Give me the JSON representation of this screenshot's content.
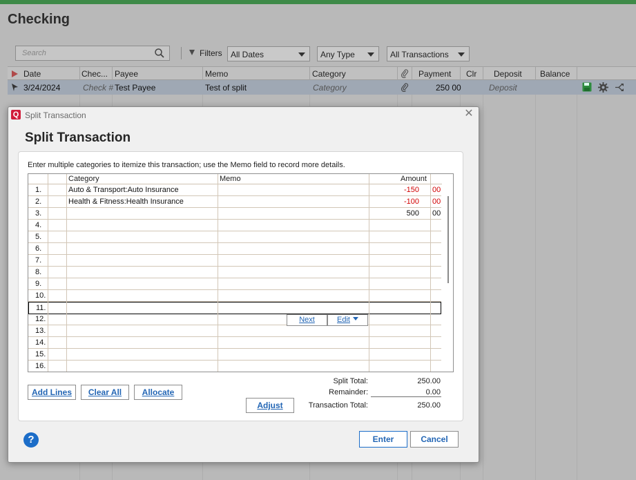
{
  "register": {
    "title": "Checking",
    "search_placeholder": "Search",
    "filters_label": "Filters",
    "date_filter": "All Dates",
    "type_filter": "Any Type",
    "txn_filter": "All Transactions",
    "columns": [
      "Date",
      "Chec...",
      "Payee",
      "Memo",
      "Category",
      "Payment",
      "Clr",
      "Deposit",
      "Balance"
    ],
    "row": {
      "date": "3/24/2024",
      "check": "Check #",
      "payee": "Test Payee",
      "memo": "Test of split",
      "category": "Category",
      "payment": "250 00",
      "deposit": "Deposit"
    }
  },
  "dialog": {
    "window_title": "Split Transaction",
    "logo": "Q",
    "heading": "Split Transaction",
    "instructions": "Enter multiple categories to itemize this transaction; use the Memo field to record more details.",
    "columns": {
      "category": "Category",
      "memo": "Memo",
      "amount": "Amount"
    },
    "rows": [
      {
        "n": "1.",
        "category": "Auto & Transport:Auto Insurance",
        "amount": "-150",
        "cents": "00",
        "negative": true
      },
      {
        "n": "2.",
        "category": "Health & Fitness:Health Insurance",
        "amount": "-100",
        "cents": "00",
        "negative": true
      },
      {
        "n": "3.",
        "category": "",
        "amount": "500",
        "cents": "00",
        "negative": false
      },
      {
        "n": "4.",
        "category": "",
        "amount": "",
        "cents": ""
      },
      {
        "n": "5.",
        "category": "",
        "amount": "",
        "cents": ""
      },
      {
        "n": "6.",
        "category": "",
        "amount": "",
        "cents": ""
      },
      {
        "n": "7.",
        "category": "",
        "amount": "",
        "cents": ""
      },
      {
        "n": "8.",
        "category": "",
        "amount": "",
        "cents": ""
      },
      {
        "n": "9.",
        "category": "",
        "amount": "",
        "cents": ""
      },
      {
        "n": "10.",
        "category": "",
        "amount": "",
        "cents": ""
      },
      {
        "n": "11.",
        "category": "",
        "amount": "",
        "cents": ""
      },
      {
        "n": "12.",
        "category": "",
        "amount": "",
        "cents": ""
      },
      {
        "n": "13.",
        "category": "",
        "amount": "",
        "cents": ""
      },
      {
        "n": "14.",
        "category": "",
        "amount": "",
        "cents": ""
      },
      {
        "n": "15.",
        "category": "",
        "amount": "",
        "cents": ""
      },
      {
        "n": "16.",
        "category": "",
        "amount": "",
        "cents": ""
      }
    ],
    "next_label": "Next",
    "edit_label": "Edit",
    "add_lines": "Add Lines",
    "clear_all": "Clear All",
    "allocate": "Allocate",
    "adjust": "Adjust",
    "split_total_label": "Split Total:",
    "split_total": "250.00",
    "remainder_label": "Remainder:",
    "remainder": "0.00",
    "transaction_total_label": "Transaction Total:",
    "transaction_total": "250.00",
    "help": "?",
    "enter": "Enter",
    "cancel": "Cancel"
  },
  "colors": {
    "accent": "#2366b5",
    "negative": "#d10000",
    "brand": "#d11d3b",
    "topbar": "#3e8a48"
  }
}
